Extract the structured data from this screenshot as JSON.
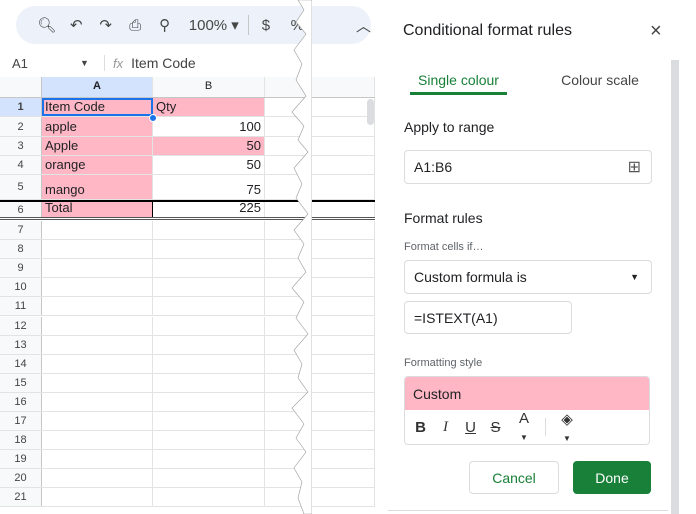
{
  "toolbar": {
    "zoom": "100%",
    "currency": "$",
    "percent": "%"
  },
  "formula_bar": {
    "cell_ref": "A1",
    "fx": "fx",
    "value": "Item Code"
  },
  "sheet": {
    "columns": [
      "A",
      "B"
    ],
    "rows": [
      {
        "n": "1",
        "a": "Item Code",
        "b": "Qty"
      },
      {
        "n": "2",
        "a": "apple",
        "b": "100"
      },
      {
        "n": "3",
        "a": "Apple",
        "b": "50"
      },
      {
        "n": "4",
        "a": "orange",
        "b": "50"
      },
      {
        "n": "5",
        "a": "mango",
        "b": "75"
      },
      {
        "n": "6",
        "a": "Total",
        "b": "225"
      }
    ],
    "empty_rows": [
      "7",
      "8",
      "9",
      "10",
      "11",
      "12",
      "13",
      "14",
      "15",
      "16",
      "17",
      "18",
      "19",
      "20",
      "21"
    ],
    "highlight_color": "#ffb7c5"
  },
  "panel": {
    "title": "Conditional format rules",
    "tabs": [
      {
        "label": "Single colour",
        "active": true
      },
      {
        "label": "Colour scale",
        "active": false
      }
    ],
    "apply_label": "Apply to range",
    "range": "A1:B6",
    "format_rules_label": "Format rules",
    "format_cells_if": "Format cells if…",
    "condition": "Custom formula is",
    "formula": "=ISTEXT(A1)",
    "formatting_style_label": "Formatting style",
    "style_preview": "Custom",
    "style_tools": [
      "B",
      "I",
      "U",
      "S",
      "A"
    ],
    "cancel": "Cancel",
    "done": "Done",
    "accent": "#188038"
  }
}
